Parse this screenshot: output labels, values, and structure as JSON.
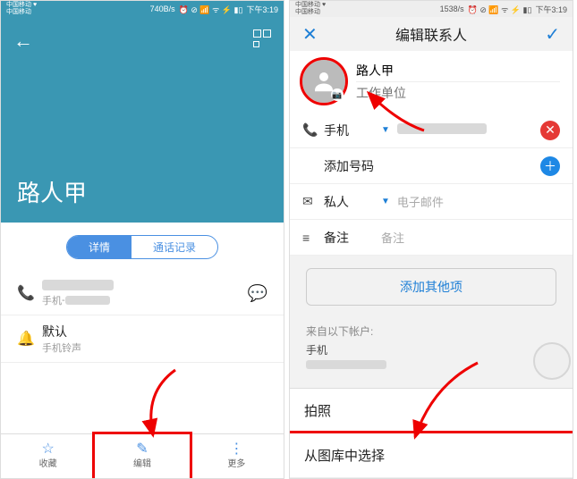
{
  "phoneA": {
    "status": {
      "carrier": "中国移动 ♥\n中国移动",
      "speed": "740B/s",
      "icons": "⏰ ⊘ 📶 ᯤ ⚡ ▮▯",
      "time": "下午3:19"
    },
    "contact_name": "路人甲",
    "tabs": {
      "details": "详情",
      "calllog": "通话记录"
    },
    "row_phone": {
      "label": "手机",
      "sep": " - "
    },
    "row_ring": {
      "title": "默认",
      "sub": "手机铃声"
    },
    "bottombar": {
      "fav": "收藏",
      "edit": "编辑",
      "more": "更多"
    }
  },
  "phoneB": {
    "status": {
      "carrier": "中国移动 ♥\n中国移动",
      "speed": "1538/s",
      "icons": "⏰ ⊘ 📶 ᯤ ⚡ ▮▯",
      "time": "下午3:19"
    },
    "title": "编辑联系人",
    "name_value": "路人甲",
    "company_placeholder": "工作单位",
    "row_phone": "手机",
    "row_addnum": "添加号码",
    "row_email_type": "私人",
    "row_email_placeholder": "电子邮件",
    "row_note": "备注",
    "row_note_placeholder": "备注",
    "more_button": "添加其他项",
    "accounts_header": "来自以下帐户:",
    "accounts_line": "手机",
    "sheet": {
      "camera": "拍照",
      "gallery": "从图库中选择"
    }
  }
}
